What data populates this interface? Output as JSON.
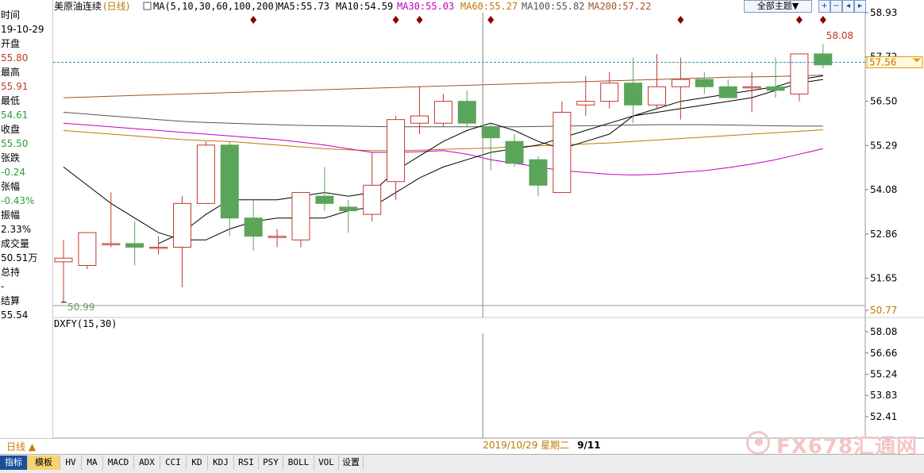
{
  "info_panel": {
    "rows": [
      {
        "text": "时间",
        "color": "#000000"
      },
      {
        "text": "19-10-29",
        "color": "#000000"
      },
      {
        "text": "开盘",
        "color": "#000000"
      },
      {
        "text": "55.80",
        "color": "#c0392b"
      },
      {
        "text": "最高",
        "color": "#000000"
      },
      {
        "text": "55.91",
        "color": "#c0392b"
      },
      {
        "text": "最低",
        "color": "#000000"
      },
      {
        "text": "54.61",
        "color": "#2e9a3a"
      },
      {
        "text": "收盘",
        "color": "#000000"
      },
      {
        "text": "55.50",
        "color": "#2e9a3a"
      },
      {
        "text": "张跌",
        "color": "#000000"
      },
      {
        "text": "-0.24",
        "color": "#2e9a3a"
      },
      {
        "text": "张幅",
        "color": "#000000"
      },
      {
        "text": "-0.43%",
        "color": "#2e9a3a"
      },
      {
        "text": "振幅",
        "color": "#000000"
      },
      {
        "text": "2.33%",
        "color": "#000000"
      },
      {
        "text": "成交量",
        "color": "#000000"
      },
      {
        "text": "50.51万",
        "color": "#000000"
      },
      {
        "text": "总持",
        "color": "#000000"
      },
      {
        "text": "-",
        "color": "#000000"
      },
      {
        "text": "结算",
        "color": "#000000"
      },
      {
        "text": "55.54",
        "color": "#000000"
      }
    ]
  },
  "header": {
    "title": "美原油连续",
    "period": "(日线)",
    "ma_label": "MA(5,10,30,60,100,200)",
    "ma_values": [
      {
        "text": "MA5:55.73",
        "color": "#000000"
      },
      {
        "text": "MA10:54.59",
        "color": "#000000"
      },
      {
        "text": "MA30:55.03",
        "color": "#c000c0"
      },
      {
        "text": "MA60:55.27",
        "color": "#c07800"
      },
      {
        "text": "MA100:55.82",
        "color": "#555555"
      },
      {
        "text": "MA200:57.22",
        "color": "#a0522d"
      }
    ],
    "theme_button": "全部主题▼",
    "toolbar_icons": [
      "plus-icon",
      "minus-icon",
      "back-icon",
      "forward-icon"
    ]
  },
  "indicator": {
    "label": "DXFY(15,30)",
    "axis_ticks": [
      58.08,
      56.66,
      55.24,
      53.83,
      52.41
    ],
    "axis_labels": [
      "58.08",
      "56.66",
      "55.24",
      "53.83",
      "52.41"
    ]
  },
  "crosshair": {
    "date_label": "2019/10/29",
    "weekday_label": "星期二",
    "next_label": "9/11",
    "price_tag": "57.56"
  },
  "period_selector": "日线 ▲",
  "bottom_tabs": [
    "指标",
    "模板",
    "HV",
    "MA",
    "MACD",
    "ADX",
    "CCI",
    "KD",
    "KDJ",
    "RSI",
    "PSY",
    "BOLL",
    "VOL",
    "设置"
  ],
  "watermark": "FX678汇通网",
  "colors": {
    "up": "#c0392b",
    "down": "#5aa55a",
    "ma5": "#000000",
    "ma10": "#000000",
    "ma30": "#c000c0",
    "ma60": "#c07800",
    "ma100": "#555555",
    "ma200": "#a0522d",
    "event_marker": "#8b0000",
    "last_price_line": "#3a8fb5"
  },
  "chart_data": {
    "type": "candlestick",
    "y_axis_ticks": [
      58.93,
      57.72,
      56.5,
      55.29,
      54.08,
      52.86,
      51.65,
      50.77
    ],
    "y_axis_labels": [
      "58.93",
      "57.72",
      "56.50",
      "55.29",
      "54.08",
      "52.86",
      "51.65",
      "50.77"
    ],
    "ylim": [
      50.77,
      58.93
    ],
    "high_annotation": "58.08",
    "low_annotation": "50.99",
    "last_price": 57.56,
    "crosshair_index": 18,
    "event_marker_indices": [
      8,
      14,
      15,
      18,
      26,
      31,
      32
    ],
    "candles": [
      {
        "o": 52.1,
        "h": 52.7,
        "l": 50.99,
        "c": 52.2
      },
      {
        "o": 52.0,
        "h": 52.9,
        "l": 51.9,
        "c": 52.9
      },
      {
        "o": 52.6,
        "h": 54.0,
        "l": 52.5,
        "c": 52.6
      },
      {
        "o": 52.6,
        "h": 53.2,
        "l": 52.0,
        "c": 52.5
      },
      {
        "o": 52.5,
        "h": 52.8,
        "l": 52.3,
        "c": 52.5
      },
      {
        "o": 52.5,
        "h": 53.9,
        "l": 51.4,
        "c": 53.7
      },
      {
        "o": 53.7,
        "h": 55.4,
        "l": 53.7,
        "c": 55.3
      },
      {
        "o": 55.3,
        "h": 55.4,
        "l": 52.8,
        "c": 53.3
      },
      {
        "o": 53.3,
        "h": 53.8,
        "l": 52.4,
        "c": 52.8
      },
      {
        "o": 52.8,
        "h": 53.0,
        "l": 52.5,
        "c": 52.8
      },
      {
        "o": 52.7,
        "h": 54.0,
        "l": 52.5,
        "c": 54.0
      },
      {
        "o": 53.9,
        "h": 54.7,
        "l": 53.5,
        "c": 53.7
      },
      {
        "o": 53.6,
        "h": 53.8,
        "l": 52.9,
        "c": 53.5
      },
      {
        "o": 53.4,
        "h": 55.1,
        "l": 53.2,
        "c": 54.2
      },
      {
        "o": 54.3,
        "h": 56.1,
        "l": 53.8,
        "c": 56.0
      },
      {
        "o": 55.9,
        "h": 56.9,
        "l": 55.6,
        "c": 56.1
      },
      {
        "o": 55.9,
        "h": 56.7,
        "l": 55.8,
        "c": 56.5
      },
      {
        "o": 56.5,
        "h": 56.8,
        "l": 55.8,
        "c": 55.9
      },
      {
        "o": 55.8,
        "h": 55.91,
        "l": 54.61,
        "c": 55.5
      },
      {
        "o": 55.4,
        "h": 55.6,
        "l": 54.7,
        "c": 54.8
      },
      {
        "o": 54.9,
        "h": 55.0,
        "l": 53.9,
        "c": 54.2
      },
      {
        "o": 54.0,
        "h": 56.5,
        "l": 54.0,
        "c": 56.2
      },
      {
        "o": 56.4,
        "h": 57.2,
        "l": 56.1,
        "c": 56.5
      },
      {
        "o": 56.5,
        "h": 57.3,
        "l": 56.3,
        "c": 57.0
      },
      {
        "o": 57.0,
        "h": 57.7,
        "l": 55.9,
        "c": 56.4
      },
      {
        "o": 56.4,
        "h": 57.8,
        "l": 56.3,
        "c": 56.9
      },
      {
        "o": 56.9,
        "h": 57.7,
        "l": 56.0,
        "c": 57.1
      },
      {
        "o": 57.1,
        "h": 57.3,
        "l": 56.7,
        "c": 56.9
      },
      {
        "o": 56.9,
        "h": 57.1,
        "l": 56.6,
        "c": 56.6
      },
      {
        "o": 56.9,
        "h": 57.3,
        "l": 56.2,
        "c": 56.9
      },
      {
        "o": 56.9,
        "h": 57.7,
        "l": 56.6,
        "c": 56.8
      },
      {
        "o": 56.7,
        "h": 57.8,
        "l": 56.5,
        "c": 57.8
      },
      {
        "o": 57.8,
        "h": 58.08,
        "l": 57.4,
        "c": 57.5
      }
    ],
    "ma5": [
      null,
      null,
      null,
      null,
      52.6,
      52.9,
      53.4,
      53.8,
      53.8,
      53.8,
      53.9,
      54.0,
      53.9,
      54.0,
      54.6,
      55.0,
      55.4,
      55.7,
      55.9,
      55.7,
      55.4,
      55.2,
      55.4,
      55.6,
      56.1,
      56.3,
      56.5,
      56.6,
      56.7,
      56.8,
      56.9,
      57.1,
      57.2
    ],
    "ma10": [
      54.7,
      54.2,
      53.7,
      53.3,
      52.9,
      52.7,
      52.7,
      53.0,
      53.2,
      53.3,
      53.3,
      53.3,
      53.5,
      53.6,
      54.0,
      54.4,
      54.7,
      54.9,
      55.1,
      55.2,
      55.3,
      55.5,
      55.7,
      55.9,
      56.1,
      56.2,
      56.3,
      56.4,
      56.5,
      56.6,
      56.8,
      57.0,
      57.1
    ],
    "ma30": [
      55.9,
      55.85,
      55.8,
      55.75,
      55.7,
      55.65,
      55.6,
      55.55,
      55.5,
      55.45,
      55.38,
      55.3,
      55.2,
      55.1,
      55.1,
      55.12,
      55.15,
      55.05,
      54.9,
      54.8,
      54.7,
      54.6,
      54.55,
      54.5,
      54.48,
      54.5,
      54.55,
      54.6,
      54.68,
      54.78,
      54.9,
      55.05,
      55.2
    ],
    "ma60": [
      55.7,
      55.65,
      55.6,
      55.55,
      55.5,
      55.45,
      55.42,
      55.4,
      55.35,
      55.3,
      55.25,
      55.2,
      55.17,
      55.15,
      55.15,
      55.16,
      55.18,
      55.2,
      55.22,
      55.25,
      55.28,
      55.3,
      55.33,
      55.36,
      55.4,
      55.44,
      55.48,
      55.52,
      55.56,
      55.6,
      55.64,
      55.68,
      55.72
    ],
    "ma100": [
      56.2,
      56.15,
      56.1,
      56.05,
      56.0,
      55.95,
      55.92,
      55.9,
      55.88,
      55.86,
      55.84,
      55.83,
      55.82,
      55.81,
      55.8,
      55.8,
      55.8,
      55.8,
      55.8,
      55.8,
      55.81,
      55.82,
      55.83,
      55.84,
      55.85,
      55.86,
      55.86,
      55.86,
      55.85,
      55.84,
      55.83,
      55.82,
      55.82
    ],
    "ma200": [
      56.6,
      56.62,
      56.64,
      56.66,
      56.68,
      56.7,
      56.72,
      56.74,
      56.76,
      56.78,
      56.8,
      56.82,
      56.84,
      56.86,
      56.88,
      56.9,
      56.92,
      56.94,
      56.96,
      56.98,
      57.0,
      57.02,
      57.04,
      57.06,
      57.08,
      57.1,
      57.12,
      57.14,
      57.16,
      57.17,
      57.18,
      57.2,
      57.22
    ]
  }
}
